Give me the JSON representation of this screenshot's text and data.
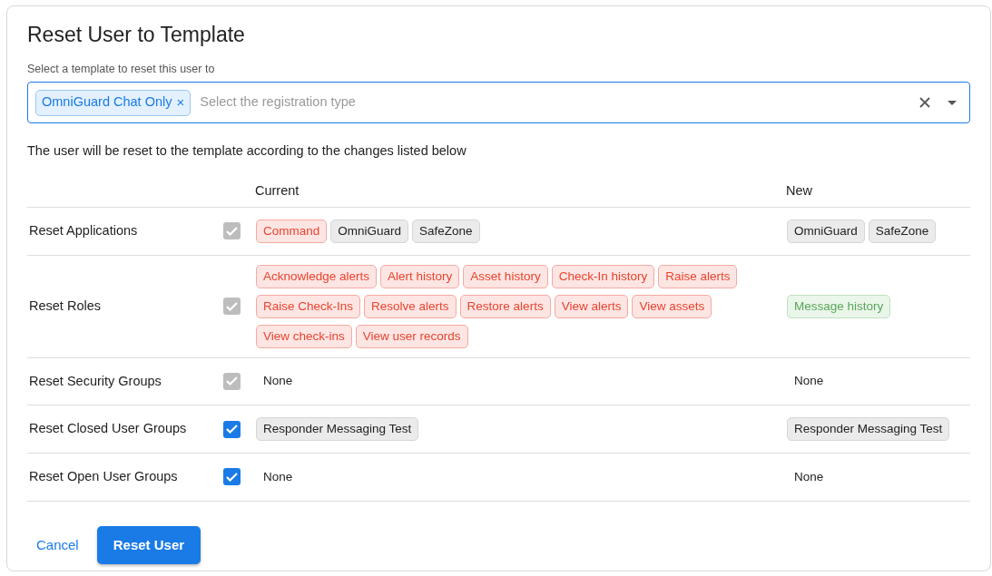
{
  "title": "Reset User to Template",
  "template_field": {
    "label": "Select a template to reset this user to",
    "placeholder": "Select the registration type",
    "chips": [
      "OmniGuard Chat Only"
    ],
    "remove_glyph": "×"
  },
  "description": "The user will be reset to the template according to the changes listed below",
  "table": {
    "columns": [
      "",
      "",
      "Current",
      "New"
    ],
    "rows": [
      {
        "label": "Reset Applications",
        "checked": true,
        "disabled": true,
        "current": [
          {
            "text": "Command",
            "kind": "removed"
          },
          {
            "text": "OmniGuard",
            "kind": "same"
          },
          {
            "text": "SafeZone",
            "kind": "same"
          }
        ],
        "new": [
          {
            "text": "OmniGuard",
            "kind": "same"
          },
          {
            "text": "SafeZone",
            "kind": "same"
          }
        ]
      },
      {
        "label": "Reset Roles",
        "checked": true,
        "disabled": true,
        "current": [
          {
            "text": "Acknowledge alerts",
            "kind": "removed"
          },
          {
            "text": "Alert history",
            "kind": "removed"
          },
          {
            "text": "Asset history",
            "kind": "removed"
          },
          {
            "text": "Check-In history",
            "kind": "removed"
          },
          {
            "text": "Raise alerts",
            "kind": "removed"
          },
          {
            "text": "Raise Check-Ins",
            "kind": "removed"
          },
          {
            "text": "Resolve alerts",
            "kind": "removed"
          },
          {
            "text": "Restore alerts",
            "kind": "removed"
          },
          {
            "text": "View alerts",
            "kind": "removed"
          },
          {
            "text": "View assets",
            "kind": "removed"
          },
          {
            "text": "View check-ins",
            "kind": "removed"
          },
          {
            "text": "View user records",
            "kind": "removed"
          }
        ],
        "new": [
          {
            "text": "Message history",
            "kind": "added"
          }
        ]
      },
      {
        "label": "Reset Security Groups",
        "checked": true,
        "disabled": true,
        "current": [
          {
            "text": "None",
            "kind": "plain"
          }
        ],
        "new": [
          {
            "text": "None",
            "kind": "plain"
          }
        ]
      },
      {
        "label": "Reset Closed User Groups",
        "checked": true,
        "disabled": false,
        "current": [
          {
            "text": "Responder Messaging Test",
            "kind": "same"
          }
        ],
        "new": [
          {
            "text": "Responder Messaging Test",
            "kind": "same"
          }
        ]
      },
      {
        "label": "Reset Open User Groups",
        "checked": true,
        "disabled": false,
        "current": [
          {
            "text": "None",
            "kind": "plain"
          }
        ],
        "new": [
          {
            "text": "None",
            "kind": "plain"
          }
        ]
      }
    ]
  },
  "buttons": [
    {
      "label": "Cancel",
      "kind": "link"
    },
    {
      "label": "Reset User",
      "kind": "primary"
    }
  ]
}
